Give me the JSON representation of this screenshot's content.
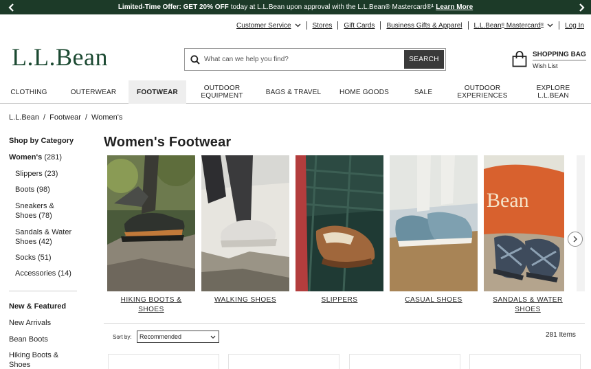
{
  "promo": {
    "bold_text": "Limited-Time Offer: GET 20% OFF",
    "text": "today at L.L.Bean upon approval with the L.L.Bean® Mastercard®¹",
    "link": "Learn More"
  },
  "utility": {
    "customer_service": "Customer Service",
    "stores": "Stores",
    "gift_cards": "Gift Cards",
    "business_gifts": "Business Gifts & Apparel",
    "mastercard": "L.L.Bean",
    "mastercard_reg": "®",
    "mastercard_2": " Mastercard",
    "log_in": "Log In"
  },
  "logo": "L.L.Bean",
  "search": {
    "placeholder": "What can we help you find?",
    "button": "SEARCH"
  },
  "bag": {
    "label": "SHOPPING BAG",
    "wishlist": "Wish List"
  },
  "nav": {
    "clothing": "CLOTHING",
    "outerwear": "OUTERWEAR",
    "footwear": "FOOTWEAR",
    "outdoor_equipment_1": "OUTDOOR",
    "outdoor_equipment_2": "EQUIPMENT",
    "bags_travel": "BAGS & TRAVEL",
    "home_goods": "HOME GOODS",
    "sale": "SALE",
    "outdoor_experiences_1": "OUTDOOR",
    "outdoor_experiences_2": "EXPERIENCES",
    "explore_1": "EXPLORE",
    "explore_2": "L.L.BEAN"
  },
  "breadcrumb": [
    "L.L.Bean",
    "Footwear",
    "Women's"
  ],
  "sidebar": {
    "shop_by_category": "Shop by Category",
    "womens_label": "Women's",
    "womens_count": "(281)",
    "slippers": "Slippers (23)",
    "boots": "Boots (98)",
    "sneakers_1": "Sneakers &",
    "sneakers_2": "Shoes (78)",
    "sandals_1": "Sandals & Water",
    "sandals_2": "Shoes (42)",
    "socks": "Socks (51)",
    "accessories": "Accessories (14)",
    "new_featured": "New & Featured",
    "new_arrivals": "New Arrivals",
    "bean_boots": "Bean Boots",
    "hiking_1": "Hiking Boots &",
    "hiking_2": "Shoes"
  },
  "page_title": "Women's Footwear",
  "categories": [
    {
      "label": "HIKING BOOTS & SHOES"
    },
    {
      "label": "WALKING SHOES"
    },
    {
      "label": "SLIPPERS"
    },
    {
      "label": "CASUAL SHOES"
    },
    {
      "label_1": "SANDALS & WATER",
      "label_2": "SHOES",
      "bag_text": "Bean"
    }
  ],
  "sort": {
    "label": "Sort by:",
    "value": "Recommended"
  },
  "item_count": "281 Items",
  "colors": {
    "promo_bg": "#1c3a28",
    "logo": "#1c4a32",
    "search_button": "#3a3a3a"
  }
}
